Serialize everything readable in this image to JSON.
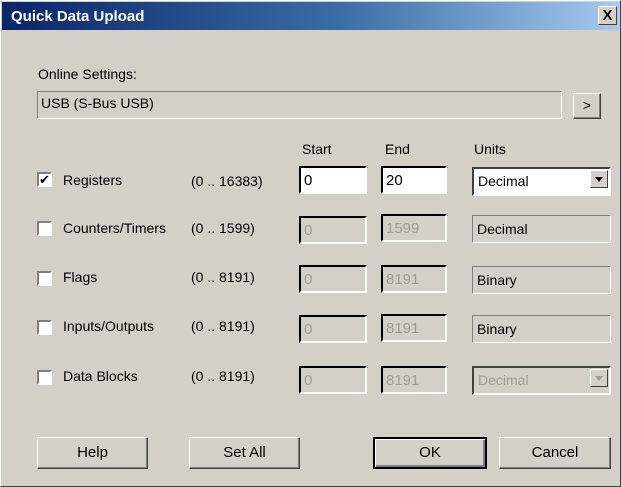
{
  "window": {
    "title": "Quick Data Upload",
    "close_label": "X"
  },
  "online": {
    "label": "Online Settings:",
    "value": "USB (S-Bus USB)",
    "more_label": ">"
  },
  "headers": {
    "start": "Start",
    "end": "End",
    "units": "Units"
  },
  "rows": [
    {
      "checked": "✔",
      "label": "Registers",
      "range": "(0 .. 16383)",
      "start": "0",
      "end": "20",
      "units": "Decimal"
    },
    {
      "checked": "",
      "label": "Counters/Timers",
      "range": "(0 .. 1599)",
      "start": "0",
      "end": "1599",
      "units": "Decimal"
    },
    {
      "checked": "",
      "label": "Flags",
      "range": "(0 .. 8191)",
      "start": "0",
      "end": "8191",
      "units": "Binary"
    },
    {
      "checked": "",
      "label": "Inputs/Outputs",
      "range": "(0 .. 8191)",
      "start": "0",
      "end": "8191",
      "units": "Binary"
    },
    {
      "checked": "",
      "label": "Data Blocks",
      "range": "(0 .. 8191)",
      "start": "0",
      "end": "8191",
      "units": "Decimal"
    }
  ],
  "buttons": {
    "help": "Help",
    "set_all": "Set All",
    "ok": "OK",
    "cancel": "Cancel"
  }
}
